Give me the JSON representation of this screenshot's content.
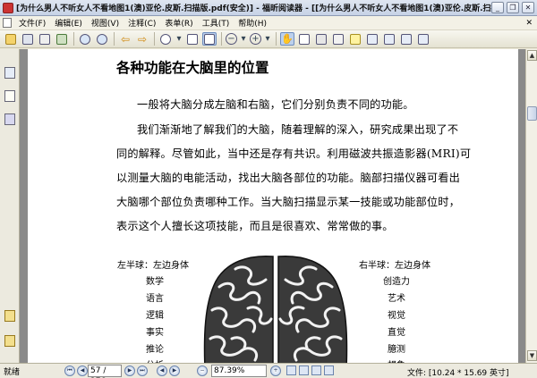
{
  "window": {
    "title": "[为什么男人不听女人不看地图1(澳)亚伦.皮斯.扫描版.pdf(安全)] - 福昕阅读器 - [[为什么男人不听女人不看地图1(澳)亚伦.皮斯.扫描版.pdf(安全)]",
    "minimize_glyph": "_",
    "restore_glyph": "❐",
    "close_glyph": "✕"
  },
  "menubar": {
    "items": [
      "文件(F)",
      "编辑(E)",
      "视图(V)",
      "注释(C)",
      "表单(R)",
      "工具(T)",
      "帮助(H)"
    ],
    "end_glyph": "✕"
  },
  "toolbar": {
    "zoom_dropdown_glyph": "▾",
    "minus_glyph": "−",
    "plus_glyph": "+"
  },
  "document": {
    "heading": "各种功能在大脑里的位置",
    "lines": [
      "一般将大脑分成左脑和右脑，它们分别负责不同的功能。",
      "我们渐渐地了解我们的大脑，随着理解的深入，研究成果出现了不",
      "同的解释。尽管如此，当中还是存有共识。利用磁波共振造影器(MRI)可",
      "以测量大脑的电能活动，找出大脑各部位的功能。脑部扫描仪器可看出",
      "大脑哪个部位负责哪种工作。当大脑扫描显示某一技能或功能部位时，",
      "表示这个人擅长这项技能，而且是很喜欢、常常做的事。"
    ],
    "figure": {
      "left_title": "左半球：左边身体",
      "right_title": "右半球：左边身体",
      "left_labels": [
        "数学",
        "语言",
        "逻辑",
        "事实",
        "推论",
        "分析"
      ],
      "right_labels": [
        "创造力",
        "艺术",
        "视觉",
        "直觉",
        "臆测",
        "想象"
      ]
    }
  },
  "statusbar": {
    "status": "就绪",
    "current_page": "57 / 276",
    "zoom": "87.39%",
    "file_info": "文件: [10.24 * 15.69 英寸]",
    "first_glyph": "⏮",
    "prev_glyph": "◀",
    "next_glyph": "▶",
    "last_glyph": "⏭",
    "back_glyph": "◀",
    "forward_glyph": "▶"
  },
  "colors": {
    "pdf_red": "#cc3333",
    "selection_blue": "#bcd0ec"
  }
}
